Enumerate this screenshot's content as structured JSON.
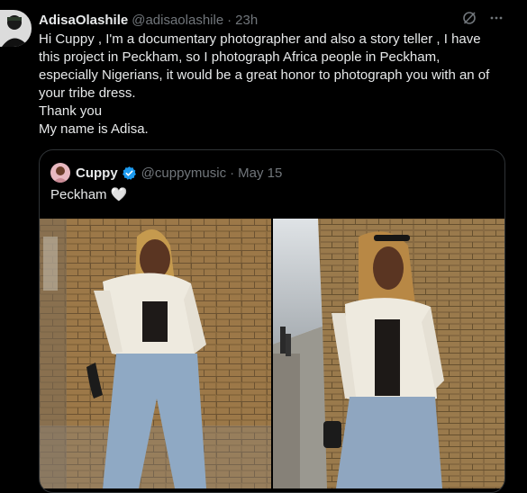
{
  "tweet": {
    "author_name": "AdisaOlashile",
    "author_handle": "@adisaolashile",
    "separator": "·",
    "time": "23h",
    "lines": [
      "Hi Cuppy , I'm a documentary photographer and also a story teller , I have",
      "this project in Peckham, so I photograph Africa people in Peckham,",
      "especially Nigerians, it would be a great honor to photograph you with an of",
      "your tribe dress.",
      "Thank you",
      "My name is Adisa."
    ]
  },
  "quoted": {
    "author_name": "Cuppy",
    "author_handle": "@cuppymusic",
    "separator": "·",
    "time": "May 15",
    "text": "Peckham 🤍"
  },
  "icons": {
    "grok": "grok-icon",
    "more": "more-icon",
    "verified": "verified-badge-icon"
  },
  "colors": {
    "background": "#000000",
    "text": "#e7e9ea",
    "secondary": "#71767b",
    "verified": "#1d9bf0",
    "border": "#2f3336"
  }
}
